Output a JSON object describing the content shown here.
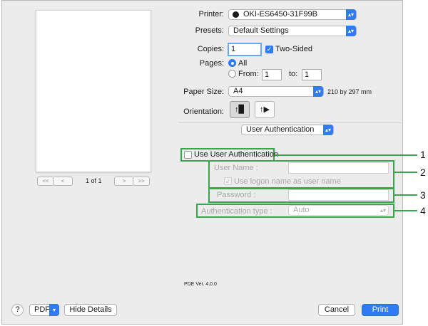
{
  "preview": {
    "first_label": "<<",
    "prev_label": "<",
    "page_indicator": "1 of 1",
    "next_label": ">",
    "last_label": ">>"
  },
  "printer": {
    "label": "Printer:",
    "value": "OKI-ES6450-31F99B"
  },
  "presets": {
    "label": "Presets:",
    "value": "Default Settings"
  },
  "copies": {
    "label": "Copies:",
    "value": "1",
    "two_sided_label": "Two-Sided",
    "two_sided_checked": true
  },
  "pages": {
    "label": "Pages:",
    "all_label": "All",
    "from_label": "From:",
    "from_value": "1",
    "to_label": "to:",
    "to_value": "1"
  },
  "paper_size": {
    "label": "Paper Size:",
    "value": "A4",
    "dimensions": "210 by 297 mm"
  },
  "orientation": {
    "label": "Orientation:"
  },
  "section_popup": {
    "value": "User Authentication"
  },
  "auth": {
    "use_label": "Use User Authentication",
    "user_name_label": "User Name :",
    "logon_label": "Use logon name as user name",
    "password_label": "Password :",
    "type_label": "Authentication type :",
    "type_value": "Auto"
  },
  "callouts": [
    "1",
    "2",
    "3",
    "4"
  ],
  "pde_version": "PDE Ver. 4.0.0",
  "footer": {
    "help_label": "?",
    "pdf_label": "PDF",
    "hide_details_label": "Hide Details",
    "cancel_label": "Cancel",
    "print_label": "Print"
  },
  "colors": {
    "accent": "#2f7bf5",
    "callout": "#34a84a",
    "dialog_bg": "#ececec"
  }
}
